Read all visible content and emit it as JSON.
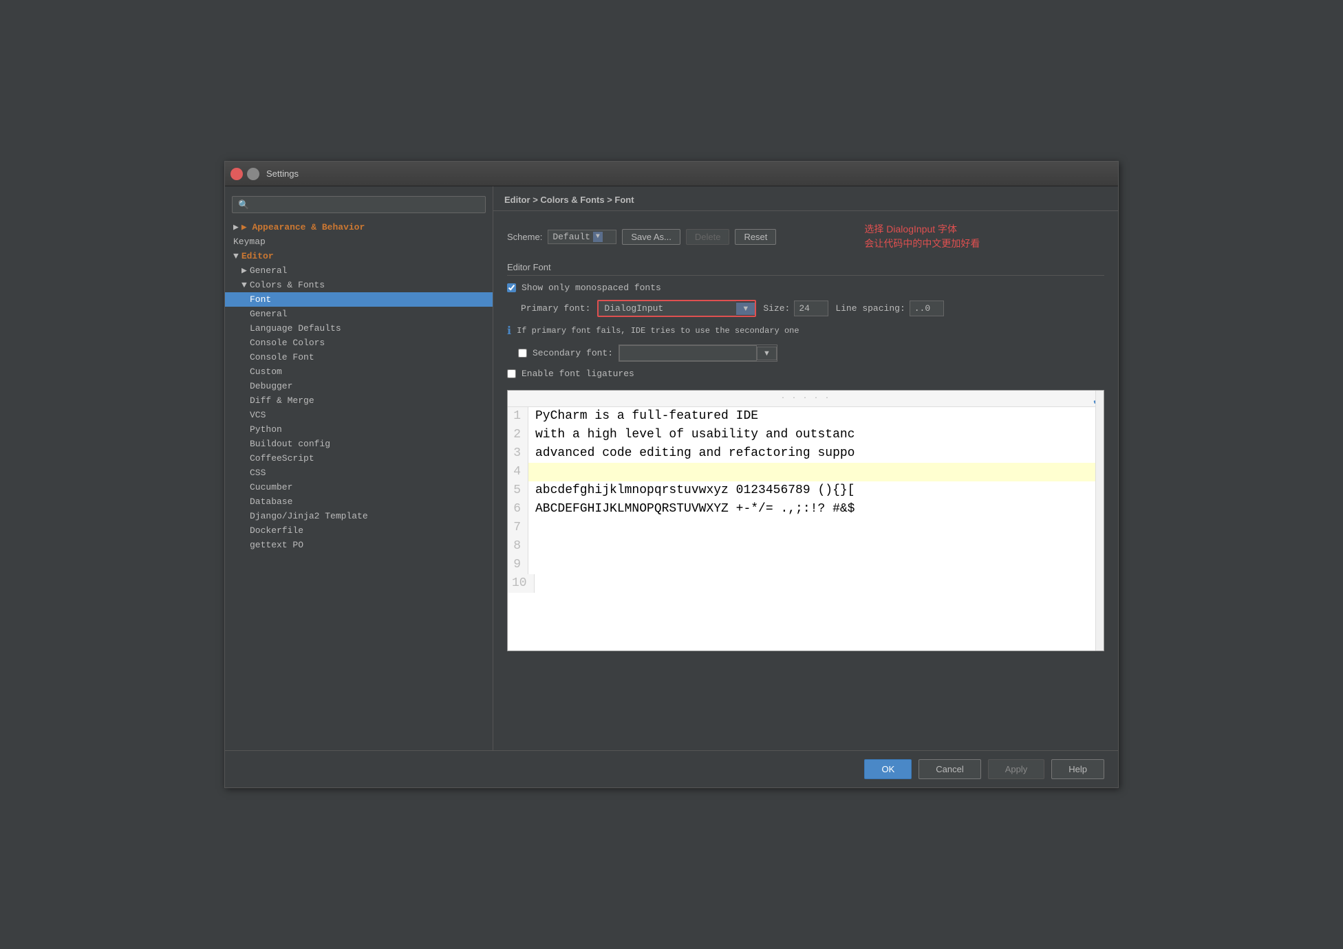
{
  "window": {
    "title": "Settings"
  },
  "breadcrumb": {
    "parts": [
      "Editor",
      "Colors & Fonts",
      "Font"
    ],
    "separator": " > "
  },
  "scheme": {
    "label": "Scheme:",
    "value": "Default",
    "buttons": {
      "save_as": "Save As...",
      "delete": "Delete",
      "reset": "Reset"
    }
  },
  "editor_font": {
    "section_title": "Editor Font",
    "annotation_line1": "选择 DialogInput 字体",
    "annotation_line2": "会让代码中的中文更加好看",
    "show_monospaced_label": "Show only monospaced fonts",
    "show_monospaced_checked": true,
    "primary_font_label": "Primary font:",
    "primary_font_value": "DialogInput",
    "size_label": "Size:",
    "size_value": "24",
    "line_spacing_label": "Line spacing:",
    "line_spacing_value": "..0",
    "info_text": "If primary font fails, IDE tries to use the secondary one",
    "secondary_font_label": "Secondary font:",
    "secondary_font_value": "",
    "enable_ligatures_label": "Enable font ligatures",
    "enable_ligatures_checked": false
  },
  "preview": {
    "lines": [
      {
        "number": "1",
        "text": "PyCharm is a full-featured IDE",
        "highlight": false
      },
      {
        "number": "2",
        "text": "with a high level of usability and outstanc",
        "highlight": false
      },
      {
        "number": "3",
        "text": "advanced code editing and refactoring suppo",
        "highlight": false
      },
      {
        "number": "4",
        "text": "",
        "highlight": true
      },
      {
        "number": "5",
        "text": "abcdefghijklmnopqrstuvwxyz 0123456789 (){}[",
        "highlight": false
      },
      {
        "number": "6",
        "text": "ABCDEFGHIJKLMNOPQRSTUVWXYZ +-*/= .,;:!? #&$",
        "highlight": false
      },
      {
        "number": "7",
        "text": "",
        "highlight": false
      },
      {
        "number": "8",
        "text": "",
        "highlight": false
      },
      {
        "number": "9",
        "text": "",
        "highlight": false
      },
      {
        "number": "10",
        "text": "",
        "highlight": false
      }
    ]
  },
  "sidebar": {
    "search_placeholder": "🔍",
    "items": [
      {
        "label": "▶ Appearance & Behavior",
        "level": 0,
        "type": "parent",
        "expanded": false
      },
      {
        "label": "Keymap",
        "level": 0,
        "type": "item"
      },
      {
        "label": "▼ Editor",
        "level": 0,
        "type": "parent-open"
      },
      {
        "label": "▶ General",
        "level": 1,
        "type": "parent"
      },
      {
        "label": "▼ Colors & Fonts",
        "level": 1,
        "type": "parent-open"
      },
      {
        "label": "Font",
        "level": 2,
        "type": "item",
        "selected": true
      },
      {
        "label": "General",
        "level": 2,
        "type": "item"
      },
      {
        "label": "Language Defaults",
        "level": 2,
        "type": "item"
      },
      {
        "label": "Console Colors",
        "level": 2,
        "type": "item"
      },
      {
        "label": "Console Font",
        "level": 2,
        "type": "item"
      },
      {
        "label": "Custom",
        "level": 2,
        "type": "item"
      },
      {
        "label": "Debugger",
        "level": 2,
        "type": "item"
      },
      {
        "label": "Diff & Merge",
        "level": 2,
        "type": "item"
      },
      {
        "label": "VCS",
        "level": 2,
        "type": "item"
      },
      {
        "label": "Python",
        "level": 2,
        "type": "item"
      },
      {
        "label": "Buildout config",
        "level": 2,
        "type": "item"
      },
      {
        "label": "CoffeeScript",
        "level": 2,
        "type": "item"
      },
      {
        "label": "CSS",
        "level": 2,
        "type": "item"
      },
      {
        "label": "Cucumber",
        "level": 2,
        "type": "item"
      },
      {
        "label": "Database",
        "level": 2,
        "type": "item"
      },
      {
        "label": "Django/Jinja2 Template",
        "level": 2,
        "type": "item"
      },
      {
        "label": "Dockerfile",
        "level": 2,
        "type": "item"
      },
      {
        "label": "gettext PO",
        "level": 2,
        "type": "item"
      }
    ]
  },
  "footer": {
    "ok": "OK",
    "cancel": "Cancel",
    "apply": "Apply",
    "help": "Help"
  }
}
